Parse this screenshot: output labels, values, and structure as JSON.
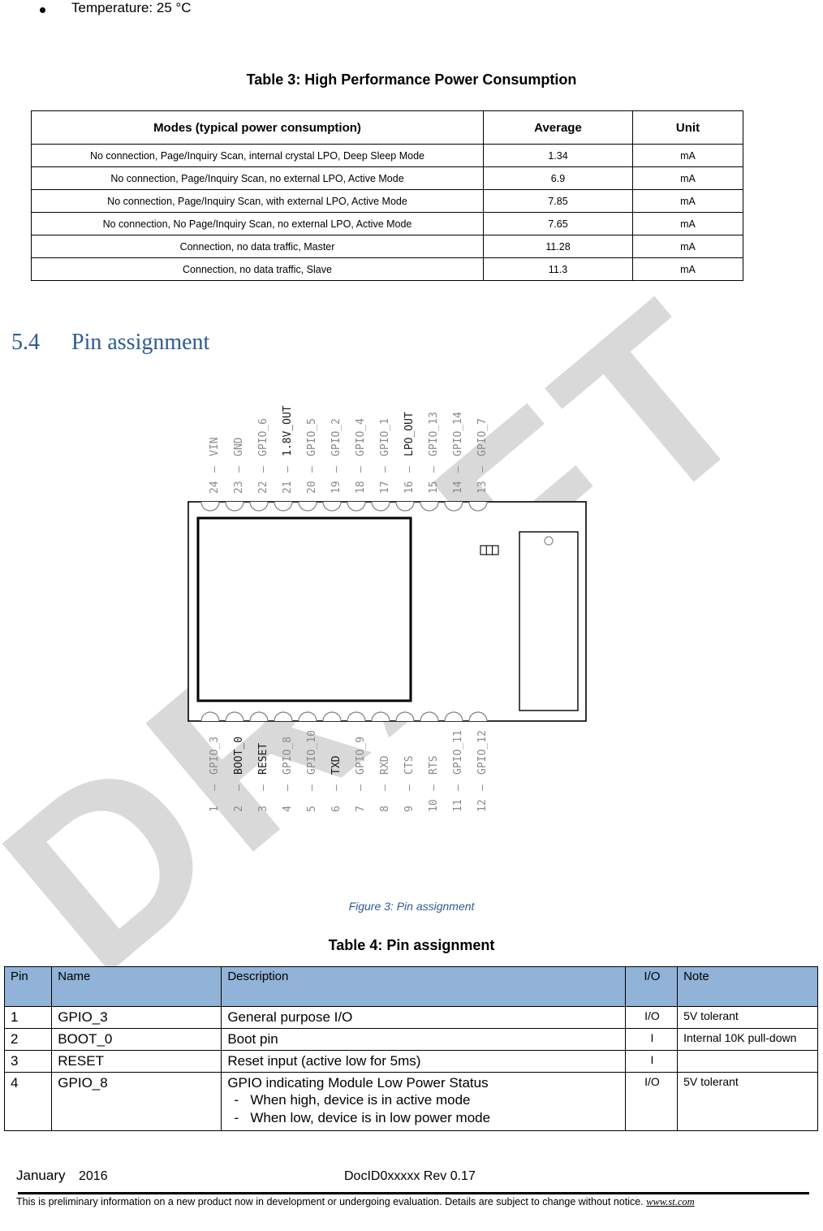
{
  "bullet": {
    "text": "Temperature: 25 °C"
  },
  "table3": {
    "caption": "Table 3: High Performance Power Consumption",
    "headers": [
      "Modes (typical power consumption)",
      "Average",
      "Unit"
    ],
    "rows": [
      [
        "No connection, Page/Inquiry Scan, internal crystal LPO, Deep Sleep Mode",
        "1.34",
        "mA"
      ],
      [
        "No connection, Page/Inquiry Scan, no external LPO, Active Mode",
        "6.9",
        "mA"
      ],
      [
        "No connection, Page/Inquiry Scan, with external LPO, Active Mode",
        "7.85",
        "mA"
      ],
      [
        "No connection, No Page/Inquiry Scan, no external LPO, Active Mode",
        "7.65",
        "mA"
      ],
      [
        "Connection, no data traffic, Master",
        "11.28",
        "mA"
      ],
      [
        "Connection, no data traffic, Slave",
        "11.3",
        "mA"
      ]
    ]
  },
  "section": {
    "number": "5.4",
    "title": "Pin assignment"
  },
  "figure": {
    "caption": "Figure 3: Pin assignment",
    "watermark": "DRAFT",
    "top_pins": [
      {
        "num": "24",
        "name": "VIN",
        "emph": false
      },
      {
        "num": "23",
        "name": "GND",
        "emph": false
      },
      {
        "num": "22",
        "name": "GPIO_6",
        "emph": false
      },
      {
        "num": "21",
        "name": "1.8V_OUT",
        "emph": true
      },
      {
        "num": "20",
        "name": "GPIO_5",
        "emph": false
      },
      {
        "num": "19",
        "name": "GPIO_2",
        "emph": false
      },
      {
        "num": "18",
        "name": "GPIO_4",
        "emph": false
      },
      {
        "num": "17",
        "name": "GPIO_1",
        "emph": false
      },
      {
        "num": "16",
        "name": "LPO_OUT",
        "emph": true
      },
      {
        "num": "15",
        "name": "GPIO_13",
        "emph": false
      },
      {
        "num": "14",
        "name": "GPIO_14",
        "emph": false
      },
      {
        "num": "13",
        "name": "GPIO_7",
        "emph": false
      }
    ],
    "bottom_pins": [
      {
        "num": "1",
        "name": "GPIO_3",
        "emph": false
      },
      {
        "num": "2",
        "name": "BOOT_0",
        "emph": true
      },
      {
        "num": "3",
        "name": "RESET",
        "emph": true
      },
      {
        "num": "4",
        "name": "GPIO_8",
        "emph": false
      },
      {
        "num": "5",
        "name": "GPIO_10",
        "emph": false
      },
      {
        "num": "6",
        "name": "TXD",
        "emph": true
      },
      {
        "num": "7",
        "name": "GPIO_9",
        "emph": false
      },
      {
        "num": "8",
        "name": "RXD",
        "emph": false
      },
      {
        "num": "9",
        "name": "CTS",
        "emph": false
      },
      {
        "num": "10",
        "name": "RTS",
        "emph": false
      },
      {
        "num": "11",
        "name": "GPIO_11",
        "emph": false
      },
      {
        "num": "12",
        "name": "GPIO_12",
        "emph": false
      }
    ]
  },
  "table4": {
    "caption": "Table 4: Pin assignment",
    "headers": [
      "Pin",
      "Name",
      "Description",
      "I/O",
      "Note"
    ],
    "header_bg": "#91b3d7",
    "rows": [
      {
        "pin": "1",
        "name": "GPIO_3",
        "description": "General purpose I/O",
        "sub_items": [],
        "io": "I/O",
        "note": "5V tolerant"
      },
      {
        "pin": "2",
        "name": "BOOT_0",
        "description": "Boot pin",
        "sub_items": [],
        "io": "I",
        "note": "Internal 10K pull-down"
      },
      {
        "pin": "3",
        "name": "RESET",
        "description": "Reset input (active low for 5ms)",
        "sub_items": [],
        "io": "I",
        "note": ""
      },
      {
        "pin": "4",
        "name": "GPIO_8",
        "description": "GPIO indicating Module Low Power Status",
        "sub_items": [
          "When high, device is in active mode",
          "When low, device is in low power mode"
        ],
        "io": "I/O",
        "note": "5V tolerant"
      }
    ]
  },
  "footer": {
    "month": "January",
    "year": "2016",
    "doc_id": "DocID0xxxxx Rev 0.17",
    "notice": "This is preliminary information on a new product now in development or undergoing   evaluation.  Details are subject to change without notice. ",
    "url": "www.st.com"
  }
}
